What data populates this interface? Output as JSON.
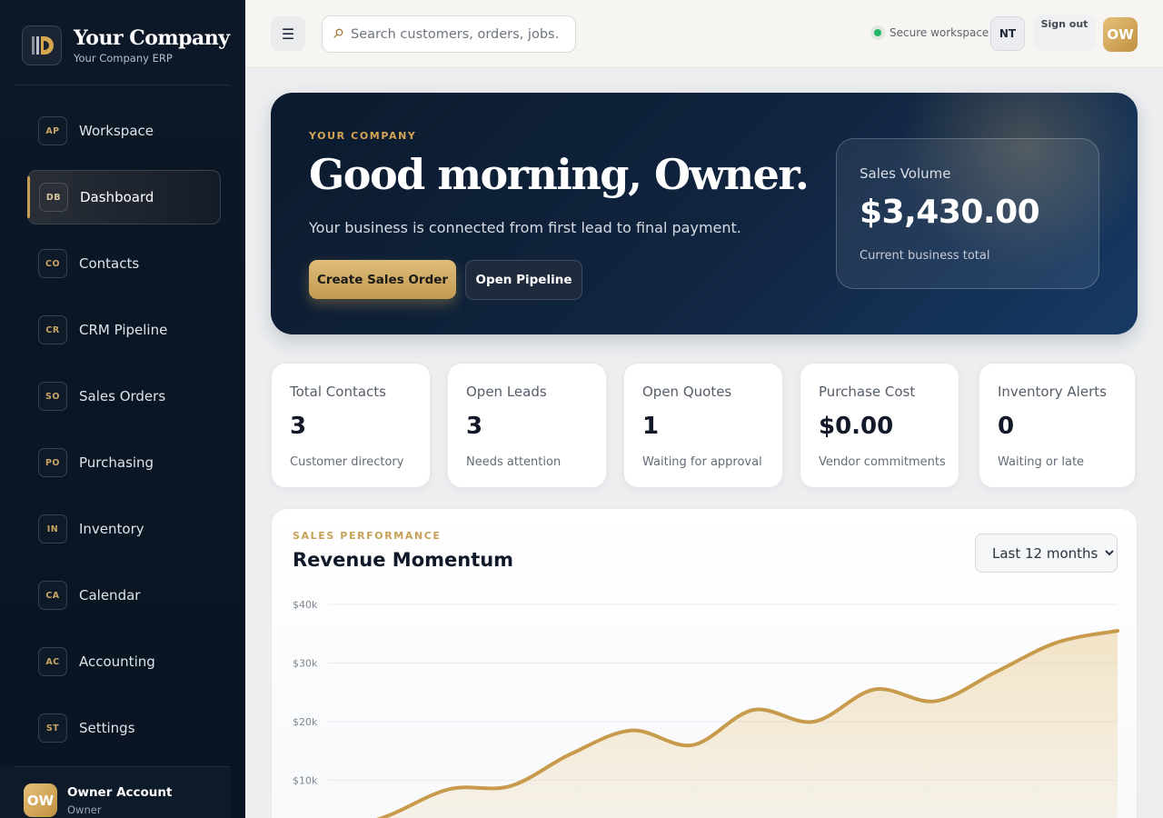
{
  "brand": {
    "name": "Your Company",
    "subtitle": "Your Company ERP"
  },
  "sidebar": {
    "items": [
      {
        "badge": "AP",
        "label": "Workspace",
        "active": false
      },
      {
        "badge": "DB",
        "label": "Dashboard",
        "active": true
      },
      {
        "badge": "CO",
        "label": "Contacts",
        "active": false
      },
      {
        "badge": "CR",
        "label": "CRM Pipeline",
        "active": false
      },
      {
        "badge": "SO",
        "label": "Sales Orders",
        "active": false
      },
      {
        "badge": "PO",
        "label": "Purchasing",
        "active": false
      },
      {
        "badge": "IN",
        "label": "Inventory",
        "active": false
      },
      {
        "badge": "CA",
        "label": "Calendar",
        "active": false
      },
      {
        "badge": "AC",
        "label": "Accounting",
        "active": false
      },
      {
        "badge": "ST",
        "label": "Settings",
        "active": false
      }
    ],
    "account": {
      "initials": "OW",
      "name": "Owner Account",
      "role": "Owner"
    }
  },
  "topbar": {
    "menu_icon": "☰",
    "search_placeholder": "Search customers, orders, jobs…",
    "secure_label": "Secure workspace",
    "nt_label": "NT",
    "signout_label": "Sign out",
    "avatar_initials": "OW"
  },
  "hero": {
    "eyebrow": "YOUR COMPANY",
    "title": "Good morning, Owner.",
    "subtitle": "Your business is connected from first lead to final payment.",
    "primary_button": "Create Sales Order",
    "secondary_button": "Open Pipeline",
    "sales_card": {
      "label": "Sales Volume",
      "value": "$3,430.00",
      "footnote": "Current business total"
    }
  },
  "stats": [
    {
      "label": "Total Contacts",
      "value": "3",
      "footnote": "Customer directory"
    },
    {
      "label": "Open Leads",
      "value": "3",
      "footnote": "Needs attention"
    },
    {
      "label": "Open Quotes",
      "value": "1",
      "footnote": "Waiting for approval"
    },
    {
      "label": "Purchase Cost",
      "value": "$0.00",
      "footnote": "Vendor commitments"
    },
    {
      "label": "Inventory Alerts",
      "value": "0",
      "footnote": "Waiting or late"
    }
  ],
  "chart_section": {
    "eyebrow": "SALES PERFORMANCE",
    "title": "Revenue Momentum",
    "range_options": [
      "Last 12 months"
    ],
    "range_selected": "Last 12 months"
  },
  "chart_data": {
    "type": "area",
    "title": "Revenue Momentum",
    "y_tick_labels": [
      "$40k",
      "$30k",
      "$20k",
      "$10k"
    ],
    "y_ticks": [
      40000,
      30000,
      20000,
      10000
    ],
    "ylim": [
      0,
      40000
    ],
    "grid": true,
    "series": [
      {
        "values": [
          500,
          4000,
          8500,
          9000,
          14500,
          18500,
          16000,
          22000,
          20000,
          25500,
          23500,
          28500,
          33500,
          35500
        ]
      }
    ],
    "colors": {
      "line": "#c89a4b",
      "fill": "#e9cf9a"
    }
  }
}
